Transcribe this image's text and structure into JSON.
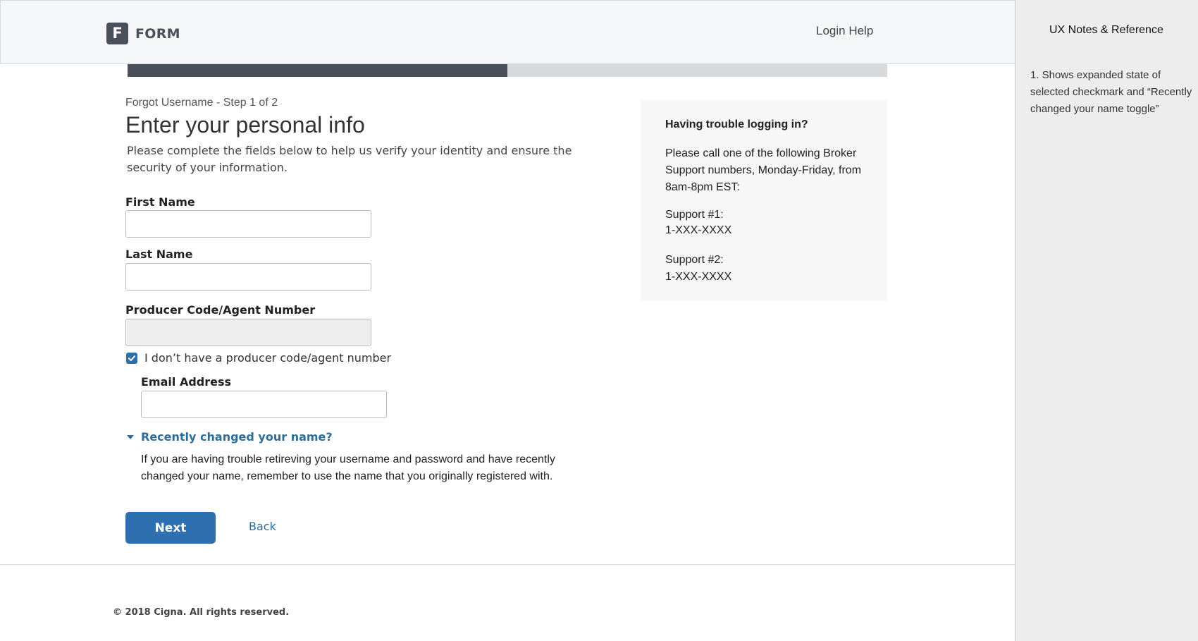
{
  "header": {
    "logo_letter": "F",
    "logo_text": "FORM",
    "login_help": "Login Help"
  },
  "progress": {
    "fraction": 0.5
  },
  "main": {
    "step_label": "Forgot Username - Step 1 of 2",
    "title": "Enter your personal info",
    "intro": "Please complete the fields below to help us verify your identity and ensure the security of your information.",
    "fields": {
      "first_name_label": "First Name",
      "last_name_label": "Last Name",
      "producer_code_label": "Producer Code/Agent Number",
      "email_label": "Email Address"
    },
    "checkbox_label": "I don’t have a producer code/agent number",
    "toggle_label": "Recently changed your name?",
    "toggle_body": "If you are having trouble retireving your username and password and have recently changed your name, remember to use the name that you originally registered with.",
    "next_label": "Next",
    "back_label": "Back"
  },
  "help": {
    "title": "Having trouble logging in?",
    "text": "Please call one of the following Broker Support numbers, Monday-Friday, from 8am-8pm EST:",
    "support1_label": "Support #1:",
    "support1_number": "1-XXX-XXXX",
    "support2_label": "Support #2:",
    "support2_number": "1-XXX-XXXX"
  },
  "footer": {
    "copyright": "© 2018 Cigna. All rights reserved."
  },
  "notes": {
    "title": "UX Notes & Reference",
    "body": "1. Shows expanded state of selected checkmark and “Recently changed your name toggle”"
  },
  "colors": {
    "brand_dark": "#4a4f5c",
    "primary_button": "#2e6fb0",
    "link": "#2b6e99"
  }
}
